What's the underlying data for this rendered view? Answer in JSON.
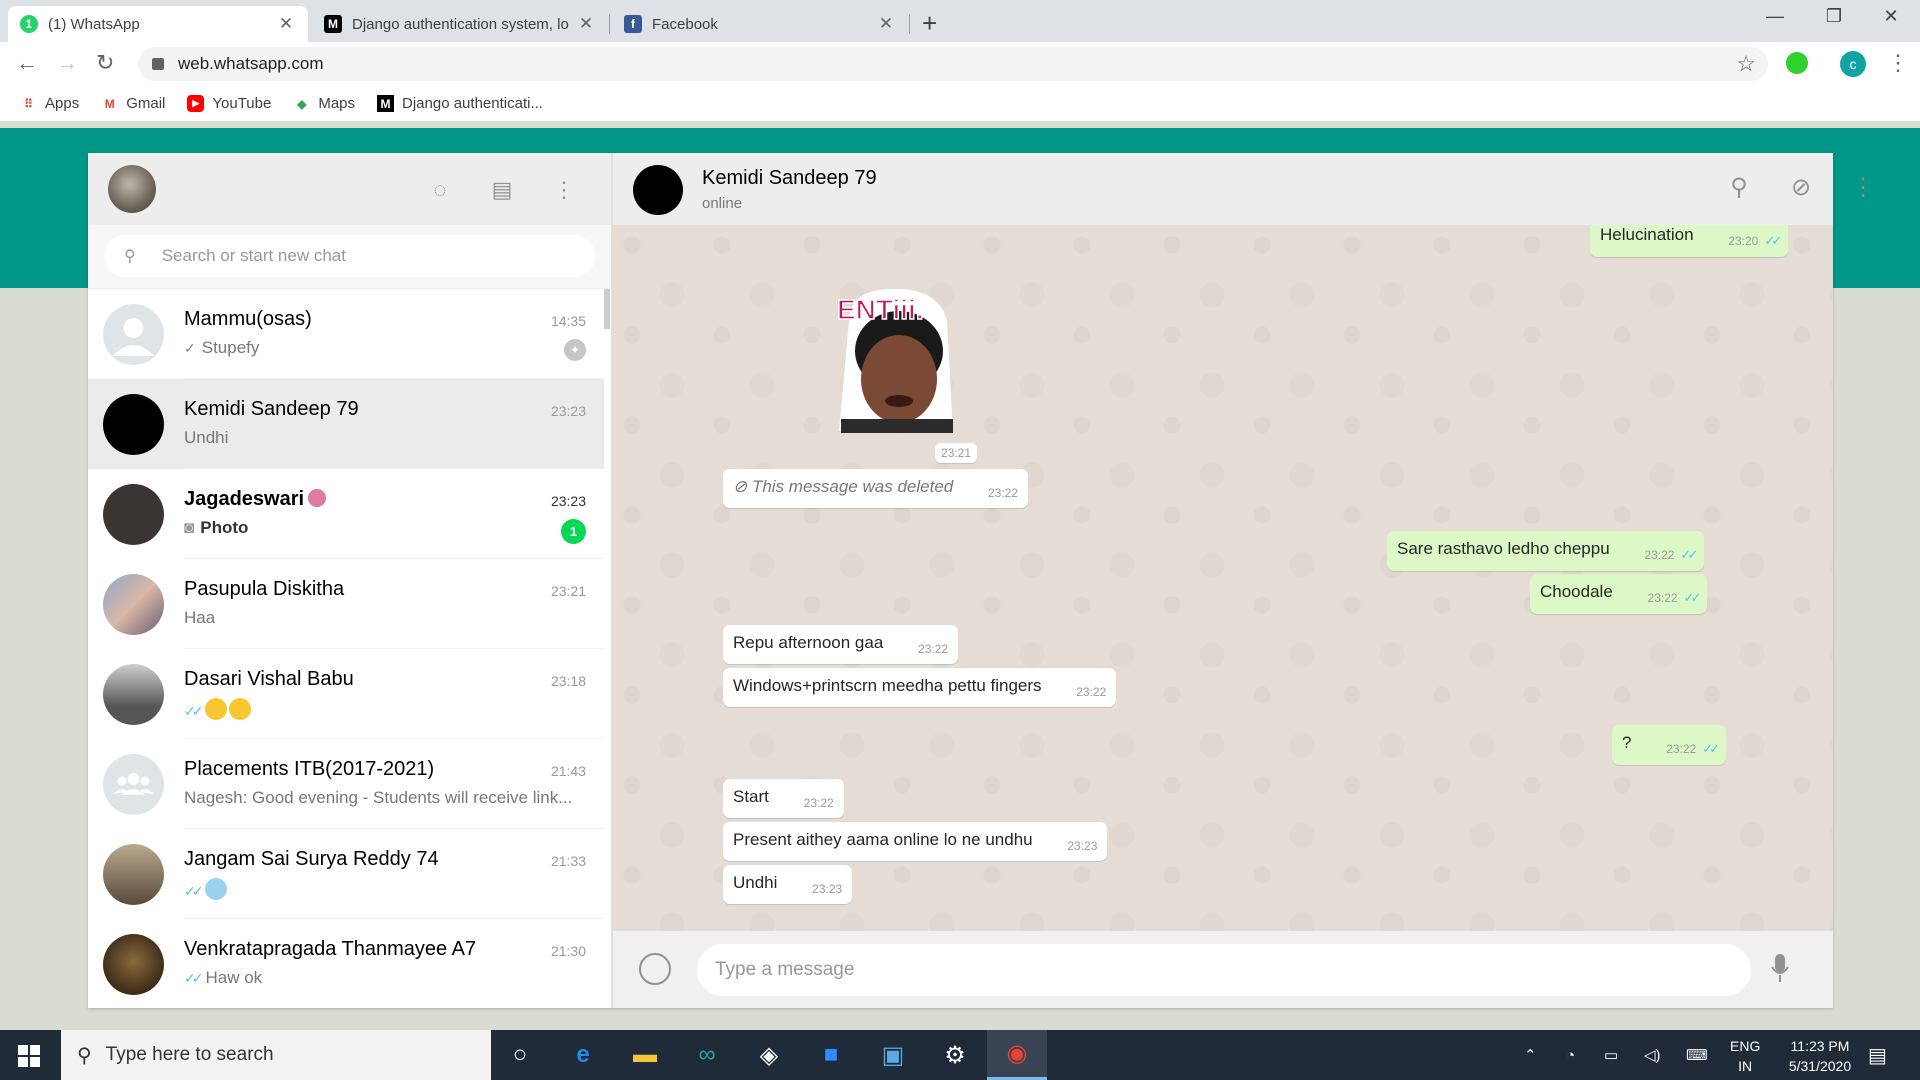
{
  "browser": {
    "tabs": [
      {
        "title": "(1) WhatsApp",
        "icon": "whatsapp-icon",
        "active": true
      },
      {
        "title": "Django authentication system, lo",
        "icon": "medium-icon",
        "active": false
      },
      {
        "title": "Facebook",
        "icon": "facebook-icon",
        "active": false
      }
    ],
    "url": "web.whatsapp.com",
    "profile_initial": "c",
    "bookmarks": [
      {
        "label": "Apps",
        "icon": "apps-grid-icon"
      },
      {
        "label": "Gmail",
        "icon": "gmail-icon"
      },
      {
        "label": "YouTube",
        "icon": "youtube-icon"
      },
      {
        "label": "Maps",
        "icon": "maps-icon"
      },
      {
        "label": "Django authenticati...",
        "icon": "medium-icon"
      }
    ]
  },
  "sidebar": {
    "search_placeholder": "Search or start new chat",
    "chats": [
      {
        "name": "Mammu(osas)",
        "time": "14:35",
        "preview": "Stupefy",
        "tick": "sent",
        "pinned": true
      },
      {
        "name": "Kemidi Sandeep 79",
        "time": "23:23",
        "preview": "Undhi",
        "selected": true
      },
      {
        "name": "Jagadeswari",
        "time": "23:23",
        "preview": "Photo",
        "unread": "1",
        "bold": true
      },
      {
        "name": "Pasupula Diskitha",
        "time": "23:21",
        "preview": "Haa"
      },
      {
        "name": "Dasari Vishal Babu",
        "time": "23:18",
        "preview": "",
        "tick": "read"
      },
      {
        "name": "Placements ITB(2017-2021)",
        "time": "21:43",
        "preview": "Nagesh: Good evening - Students will receive link..."
      },
      {
        "name": "Jangam Sai Surya Reddy 74",
        "time": "21:33",
        "preview": "",
        "tick": "read"
      },
      {
        "name": "Venkratapragada Thanmayee A7",
        "time": "21:30",
        "preview": "Haw ok",
        "tick": "read"
      }
    ]
  },
  "conversation": {
    "contact_name": "Kemidi Sandeep 79",
    "contact_status": "online",
    "sticker_text": "ENTiii.",
    "messages": [
      {
        "text": "Helucination",
        "time": "23:20",
        "dir": "out"
      },
      {
        "text": "",
        "time": "23:21",
        "dir": "in",
        "type": "sticker"
      },
      {
        "text": "This message was deleted",
        "time": "23:22",
        "dir": "in",
        "type": "deleted"
      },
      {
        "text": "Sare rasthavo ledho cheppu",
        "time": "23:22",
        "dir": "out"
      },
      {
        "text": "Choodale",
        "time": "23:22",
        "dir": "out"
      },
      {
        "text": "Repu afternoon gaa",
        "time": "23:22",
        "dir": "in"
      },
      {
        "text": "Windows+printscrn meedha pettu fingers",
        "time": "23:22",
        "dir": "in"
      },
      {
        "text": "?",
        "time": "23:22",
        "dir": "out"
      },
      {
        "text": "Start",
        "time": "23:22",
        "dir": "in"
      },
      {
        "text": "Present aithey aama online lo ne undhu",
        "time": "23:23",
        "dir": "in"
      },
      {
        "text": "Undhi",
        "time": "23:23",
        "dir": "in"
      }
    ],
    "composer_placeholder": "Type a message"
  },
  "taskbar": {
    "search_placeholder": "Type here to search",
    "language_line1": "ENG",
    "language_line2": "IN",
    "time": "11:23 PM",
    "date": "5/31/2020"
  },
  "colors": {
    "wa_teal": "#009688",
    "outgoing_bubble": "#dcf8c6",
    "unread_badge": "#06d755",
    "read_tick": "#4fc3f7"
  }
}
